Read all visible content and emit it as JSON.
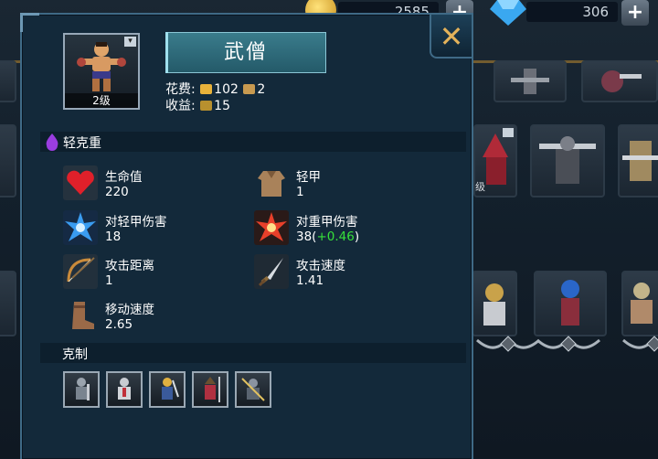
{
  "resources": {
    "gold": "2585",
    "gems": "306"
  },
  "unit": {
    "name": "武僧",
    "level": "2级",
    "cost_label": "花费:",
    "cost_gold": "102",
    "cost_pop": "2",
    "income_label": "收益:",
    "income": "15"
  },
  "armor_class": "轻克重",
  "stats": [
    {
      "label": "生命值",
      "value": "220",
      "icon": "heart-icon"
    },
    {
      "label": "轻甲",
      "value": "1",
      "icon": "light-armor-icon"
    },
    {
      "label": "对轻甲伤害",
      "value": "18",
      "icon": "blue-burst-icon"
    },
    {
      "label": "对重甲伤害",
      "value": "38(",
      "bonus": "+0.46",
      "suffix": ")",
      "icon": "red-burst-icon"
    },
    {
      "label": "攻击距离",
      "value": "1",
      "icon": "bow-icon"
    },
    {
      "label": "攻击速度",
      "value": "1.41",
      "icon": "dagger-icon"
    },
    {
      "label": "移动速度",
      "value": "2.65",
      "icon": "boot-icon"
    }
  ],
  "counters_title": "克制",
  "bg_level": "级",
  "colors": {
    "panel": "#13293a",
    "border": "#3f6a86",
    "bonus_green": "#37e03a",
    "close_gold": "#e3b25a"
  }
}
